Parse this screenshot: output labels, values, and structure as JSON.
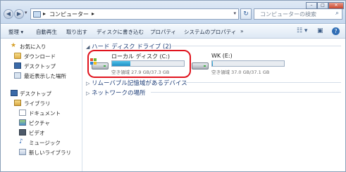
{
  "address": {
    "breadcrumb_sep": "▸",
    "crumb": "コンピューター",
    "crumb_arrow": "▸",
    "dropdown": "▾"
  },
  "nav_buttons": {
    "back": "◀",
    "forward": "▶",
    "recent": "▾"
  },
  "refresh_icon": "↻",
  "search": {
    "placeholder": "コンピューターの検索",
    "icon": "⌕"
  },
  "window_buttons": {
    "minimize": "–",
    "maximize": "□",
    "close": "✕"
  },
  "command_bar": {
    "organize": "整理 ▾",
    "autoplay": "自動再生",
    "eject": "取り出す",
    "burn": "ディスクに書き込む",
    "properties": "プロパティ",
    "system_properties": "システムのプロパティ",
    "more": "»",
    "view_icon": "☷ ▾",
    "pane_icon": "▣",
    "help_icon": "?"
  },
  "nav_pane": {
    "favorites": "お気に入り",
    "downloads": "ダウンロード",
    "desktop_fav": "デスクトップ",
    "recent": "最近表示した場所",
    "desktop": "デスクトップ",
    "libraries": "ライブラリ",
    "documents": "ドキュメント",
    "pictures": "ピクチャ",
    "videos": "ビデオ",
    "music": "ミュージック",
    "new_library": "新しいライブラリ"
  },
  "groups": {
    "hdd": "ハード ディスク ドライブ (2)",
    "removable": "リムーバブル記憶域があるデバイス",
    "network": "ネットワークの場所"
  },
  "drives": [
    {
      "name": "ローカル ディスク (C:)",
      "free_text": "空き領域 27.9 GB/37.3 GB",
      "used_fraction": 0.25
    },
    {
      "name": "WK (E:)",
      "free_text": "空き領域 37.0 GB/37.1 GB",
      "used_fraction": 0.01
    }
  ],
  "colors": {
    "highlight": "#e0141e",
    "bar_fill": "#1f8fc6"
  }
}
